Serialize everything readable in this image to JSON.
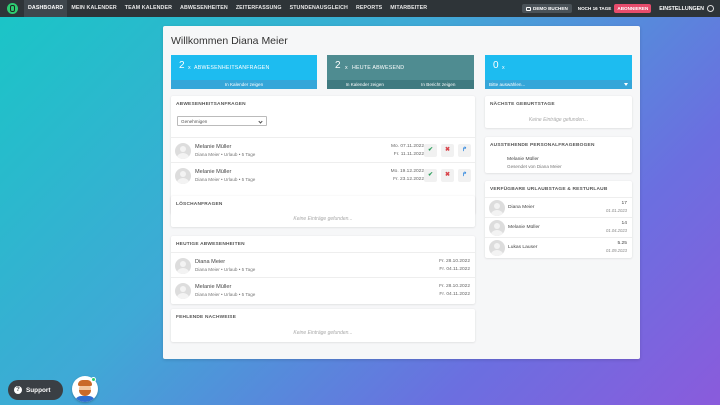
{
  "nav": {
    "items": [
      "DASHBOARD",
      "MEIN KALENDER",
      "TEAM KALENDER",
      "ABWESENHEITEN",
      "ZEITERFASSUNG",
      "STUNDENAUSGLEICH",
      "REPORTS",
      "MITARBEITER"
    ],
    "demo_label": "DEMO BUCHEN",
    "trial_label": "NOCH 16 TAGE",
    "subscribe_label": "ABONNIEREN",
    "settings_label": "EINSTELLUNGEN"
  },
  "page": {
    "title": "Willkommen Diana Meier"
  },
  "stats": [
    {
      "count": "2",
      "prefix": "x",
      "label": "ABWESENHEITSANFRAGEN",
      "links": [
        "In Kalender zeigen"
      ]
    },
    {
      "count": "2",
      "prefix": "x",
      "label": "HEUTE ABWESEND",
      "links": [
        "In Kalender zeigen",
        "In Bericht zeigen"
      ]
    },
    {
      "count": "0",
      "prefix": "x",
      "label": "",
      "links": [
        "Bitte auswählen..."
      ]
    }
  ],
  "requests": {
    "title": "ABWESENHEITSANFRAGEN",
    "filter_value": "Genehmigen",
    "rows": [
      {
        "name": "Melanie Müller",
        "detail": "Diana Meier • Urlaub • 5 Tage",
        "from": "Mo. 07.11.2022",
        "to": "Fr. 11.11.2022"
      },
      {
        "name": "Melanie Müller",
        "detail": "Diana Meier • Urlaub • 5 Tage",
        "from": "Mo. 19.12.2022",
        "to": "Fr. 23.12.2022"
      }
    ]
  },
  "deletions": {
    "title": "LÖSCHANFRAGEN",
    "empty": "Keine Einträge gefunden..."
  },
  "today": {
    "title": "HEUTIGE ABWESENHEITEN",
    "rows": [
      {
        "name": "Diana Meier",
        "detail": "Diana Meier • Urlaub • 5 Tage",
        "from": "Fr. 28.10.2022",
        "to": "Fr. 04.11.2022"
      },
      {
        "name": "Melanie Müller",
        "detail": "Diana Meier • Urlaub • 5 Tage",
        "from": "Fr. 28.10.2022",
        "to": "Fr. 04.11.2022"
      }
    ]
  },
  "missing": {
    "title": "FEHLENDE NACHWEISE",
    "empty": "Keine Einträge gefunden..."
  },
  "birthdays": {
    "title": "NÄCHSTE GEBURTSTAGE",
    "empty": "Keine Einträge gefunden..."
  },
  "questionnaires": {
    "title": "AUSSTEHENDE PERSONALFRAGEBOGEN",
    "name": "Melanie Müller",
    "detail": "Gesendet von Diana Meier"
  },
  "vacation": {
    "title": "VERFÜGBARE URLAUBSTAGE & RESTURLAUB",
    "rows": [
      {
        "name": "Diana Meier",
        "value": "17",
        "date": "01.01.2023"
      },
      {
        "name": "Melanie Müller",
        "value": "14",
        "date": "01.04.2023"
      },
      {
        "name": "Lukas Lauser",
        "value": "5.25",
        "date": "01.09.2023"
      }
    ]
  },
  "support": {
    "label": "Support"
  },
  "colors": {
    "topbar": "#2e3438",
    "accent_blue": "#1dbcf0",
    "accent_teal": "#4f8c91",
    "subscribe": "#e74c6c",
    "logo_green": "#2ecc71"
  }
}
